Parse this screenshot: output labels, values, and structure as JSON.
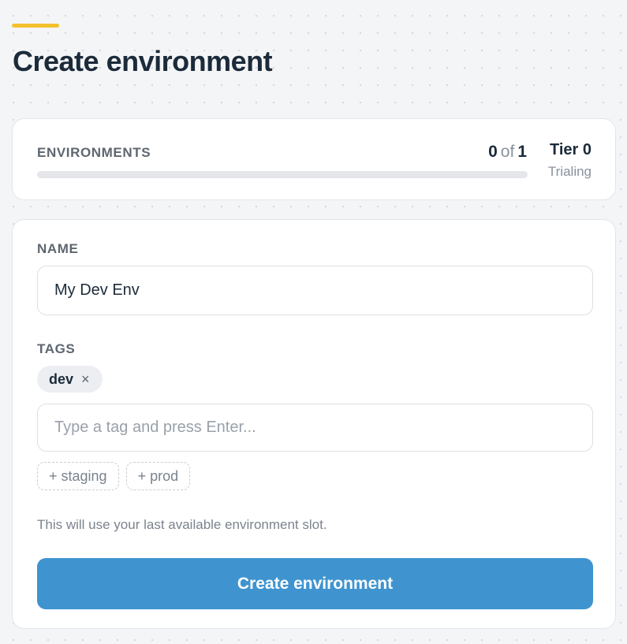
{
  "header": {
    "title": "Create environment",
    "accent_color": "#f2c12e"
  },
  "usage": {
    "label": "ENVIRONMENTS",
    "used": "0",
    "of_text": "of",
    "total": "1",
    "progress_fraction": 0,
    "tier": "Tier 0",
    "tier_status": "Trialing"
  },
  "form": {
    "name_label": "NAME",
    "name_value": "My Dev Env",
    "tags_label": "TAGS",
    "tags": [
      {
        "label": "dev",
        "remove_glyph": "×",
        "remove_icon": "close-icon"
      }
    ],
    "tag_input_placeholder": "Type a tag and press Enter...",
    "suggestions": [
      "+ staging",
      "+ prod"
    ],
    "helper_text": "This will use your last available environment slot.",
    "submit_label": "Create environment"
  },
  "colors": {
    "primary": "#3f94d0",
    "title": "#1c2b3a",
    "muted": "#8a929c"
  }
}
